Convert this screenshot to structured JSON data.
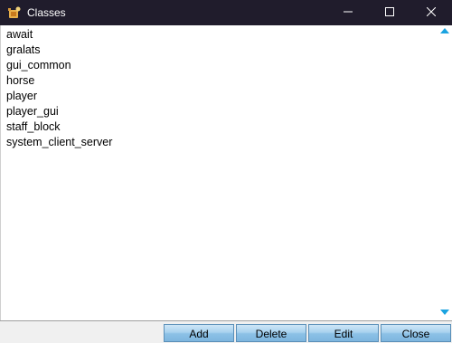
{
  "window": {
    "title": "Classes",
    "icon": "app-logo-icon",
    "controls": [
      "minimize-icon",
      "maximize-icon",
      "close-icon"
    ]
  },
  "list": {
    "items": [
      "await",
      "gralats",
      "gui_common",
      "horse",
      "player",
      "player_gui",
      "staff_block",
      "system_client_server"
    ]
  },
  "scrollbar": {
    "up_icon": "scroll-up-arrow-icon",
    "down_icon": "scroll-down-arrow-icon",
    "accent": "#1aa3e0"
  },
  "buttons": {
    "add": "Add",
    "delete": "Delete",
    "edit": "Edit",
    "close": "Close"
  },
  "colors": {
    "titlebar": "#201c2c",
    "button_fill": "#a9d2ef",
    "button_border": "#5a8fb8"
  }
}
